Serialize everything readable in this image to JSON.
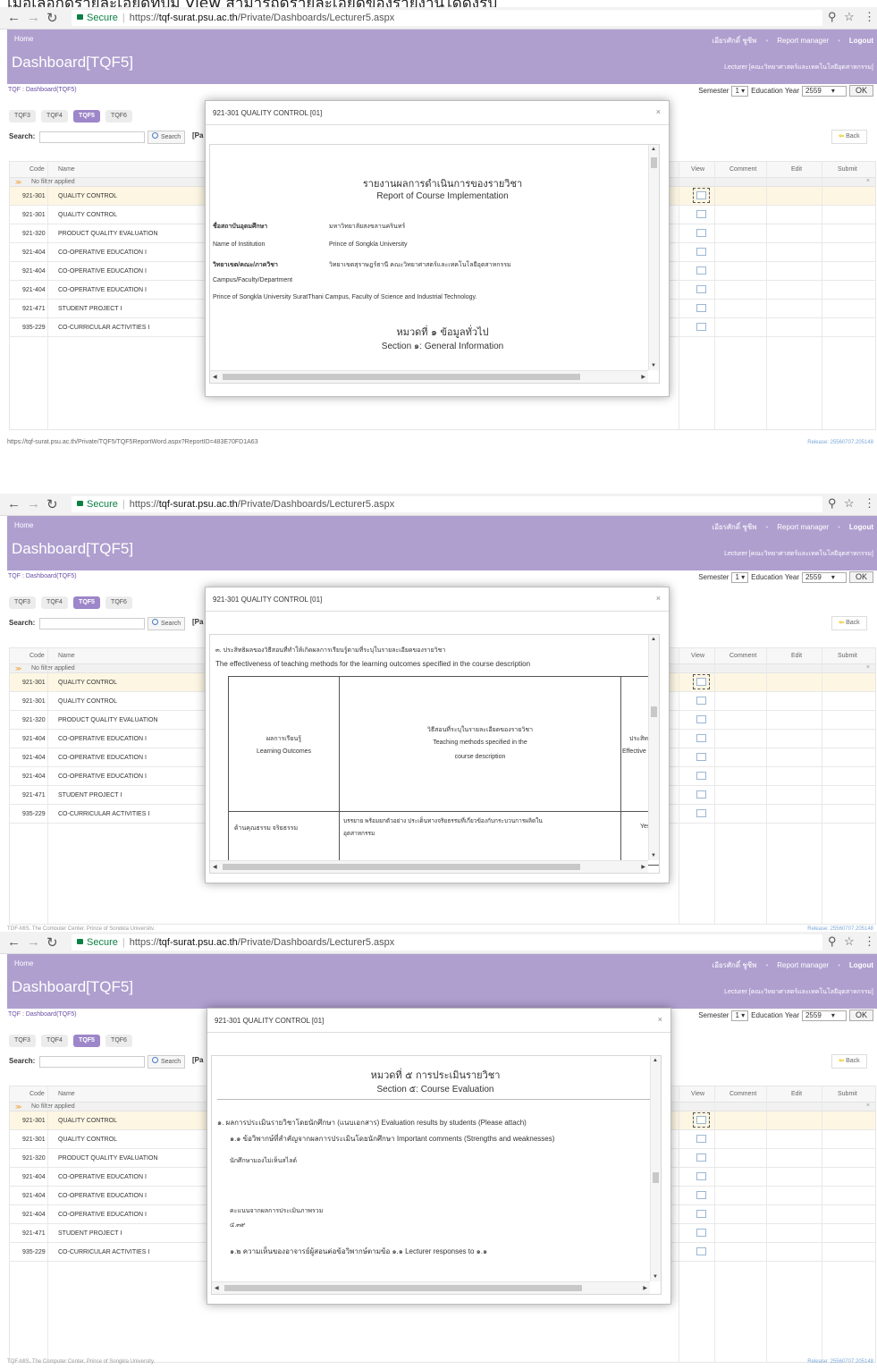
{
  "caption_fragment": "เมื่อเลือกดูรายละเอียดที่ปุ่ม View สามารถดูรายละเอียดของรายงานได้ดังรูป",
  "browser": {
    "secure_label": "Secure",
    "url_prefix": "https://",
    "url_host": "tqf-surat.psu.ac.th",
    "url_path": "/Private/Dashboards/Lecturer5.aspx"
  },
  "header": {
    "home": "Home",
    "title": "Dashboard[TQF5]",
    "user": "เอียรศักดิ์ ชูชีพ",
    "report_manager": "Report manager",
    "logout": "Logout",
    "lecturer": "Lecturer [คณะวิทยาศาสตร์และเทคโนโลยีอุตสาหกรรม]"
  },
  "breadcrumb": "TQF : Dashboard(TQF5)",
  "semester": {
    "label": "Semester",
    "value": "1",
    "year_label": "Education Year",
    "year_value": "2559",
    "ok": "OK"
  },
  "tabs": [
    "TQF3",
    "TQF4",
    "TQF5",
    "TQF6"
  ],
  "search": {
    "label": "Search:",
    "button": "Search",
    "pager_fragment": "[Pa",
    "back": "Back"
  },
  "grid": {
    "columns": {
      "code": "Code",
      "name": "Name",
      "view": "View",
      "comment": "Comment",
      "edit": "Edit",
      "submit": "Submit"
    },
    "filter": "No filter applied",
    "filter_close": "×",
    "rows": [
      {
        "code": "921-301",
        "name": "QUALITY CONTROL"
      },
      {
        "code": "921-301",
        "name": "QUALITY CONTROL"
      },
      {
        "code": "921-320",
        "name": "PRODUCT QUALITY EVALUATION"
      },
      {
        "code": "921-404",
        "name": "CO-OPERATIVE EDUCATION I"
      },
      {
        "code": "921-404",
        "name": "CO-OPERATIVE EDUCATION I"
      },
      {
        "code": "921-404",
        "name": "CO-OPERATIVE EDUCATION I"
      },
      {
        "code": "921-471",
        "name": "STUDENT PROJECT I"
      },
      {
        "code": "935-229",
        "name": "CO-CURRICULAR ACTIVITIES I"
      }
    ]
  },
  "footer": {
    "status_url": "https://tqf-surat.psu.ac.th/Private/TQF5/TQF5ReportWord.aspx?ReportID=483E70FD1A63",
    "copyright": "TQF-MIS, The Computer Center, Prince of Songkla University.",
    "release": "Release: 25560707.205148"
  },
  "modal": {
    "title": "921-301 QUALITY CONTROL [01]",
    "close": "×"
  },
  "doc1": {
    "heading_th": "รายงานผลการดำเนินการของรายวิชา",
    "heading_en": "Report of Course Implementation",
    "inst_label_th": "ชื่อสถาบันอุดมศึกษา",
    "inst_value_th": "มหาวิทยาลัยสงขลานครินทร์",
    "inst_label_en": "Name of Institution",
    "inst_value_en": "Prince of Songkla University",
    "campus_label_th": "วิทยาเขต/คณะ/ภาควิชา",
    "campus_value_th": "วิทยาเขตสุราษฎร์ธานี คณะวิทยาศาสตร์และเทคโนโลยีอุตสาหกรรม",
    "campus_label_en": "Campus/Faculty/Department",
    "campus_value_en": "Prince of Songkla University SuratThani Campus,  Faculty of Science and Industrial Technology.",
    "section_th": "หมวดที่ ๑ ข้อมูลทั่วไป",
    "section_en": "Section ๑: General Information"
  },
  "doc2": {
    "item_th": "๓. ประสิทธิผลของวิธีสอนที่ทำให้เกิดผลการเรียนรู้ตามที่ระบุในรายละเอียดของรายวิชา",
    "item_en": "The effectiveness of teaching methods for the learning outcomes specified in the course description",
    "col1_th": "ผลการเรียนรู้",
    "col1_en": "Learning Outcomes",
    "col2_th": "วิธีสอนที่ระบุในรายละเอียดของรายวิชา",
    "col2_en1": "Teaching methods specified in the",
    "col2_en2": "course description",
    "col3_th": "ประสิทธิ",
    "col3_en": "Effective",
    "row1_c1": "ด้านคุณธรรม จริยธรรม",
    "row1_c2a": "บรรยาย พร้อมยกตัวอย่าง ประเด็นทางจริยธรรมที่เกี่ยวข้องกับกระบวนการผลิตใน",
    "row1_c2b": "อุตสาหกรรม",
    "row1_c3": "Yes"
  },
  "doc3": {
    "section_th": "หมวดที่ ๕ การประเมินรายวิชา",
    "section_en": "Section ๕: Course Evaluation",
    "item1": "๑. ผลการประเมินรายวิชาโดยนักศึกษา (แนบเอกสาร) Evaluation results by students (Please attach)",
    "item11": "๑.๑ ข้อวิพากษ์ที่สำคัญจากผลการประเมินโดยนักศึกษา Important comments (Strengths and weaknesses)",
    "comment": "นักศึกษามองไม่เห็นสไลด์",
    "score_label": "คะแนนจากผลการประเมินภาพรวม",
    "score_value": "๔.๓๙",
    "item12": "๑.๒ ความเห็นของอาจารย์ผู้สอนต่อข้อวิพากษ์ตามข้อ ๑.๑ Lecturer responses to ๑.๑"
  }
}
